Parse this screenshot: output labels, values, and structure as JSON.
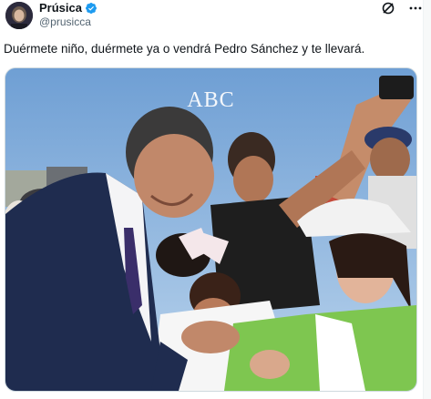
{
  "author": {
    "display_name": "Prúsica",
    "handle": "@prusicca",
    "verified": true,
    "avatar_icon": "profile-avatar"
  },
  "tweet": {
    "text": "Duérmete niño, duérmete ya o vendrá Pedro Sánchez y te llevará."
  },
  "media": {
    "watermark": "ABC",
    "image_icon": "photo-politician-holding-baby"
  },
  "top_icons": [
    "grok-icon",
    "more-icon"
  ],
  "colors": {
    "verified_blue": "#1d9bf0",
    "handle_gray": "#536471",
    "text": "#0f1419"
  }
}
